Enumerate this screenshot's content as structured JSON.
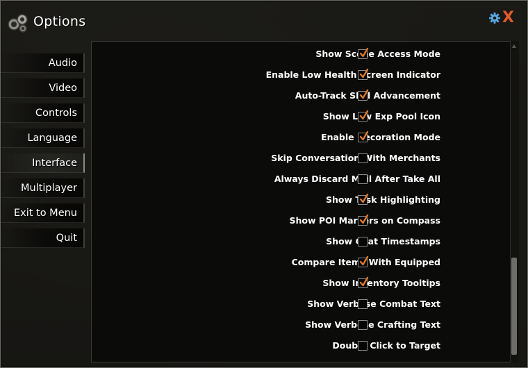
{
  "window": {
    "title": "Options"
  },
  "icons": {
    "logo": "gears-logo-icon",
    "settings": "gear-icon",
    "close": "close-icon",
    "close_glyph": "X"
  },
  "colors": {
    "accent_close": "#e05a2c",
    "gear": "#5aa8e0",
    "checkmark": "#e07a2a",
    "panel_bg": "#0b0b0a",
    "text": "#ffffff"
  },
  "nav": {
    "items": [
      {
        "label": "Audio",
        "active": false
      },
      {
        "label": "Video",
        "active": false
      },
      {
        "label": "Controls",
        "active": false
      },
      {
        "label": "Language",
        "active": false
      },
      {
        "label": "Interface",
        "active": true
      },
      {
        "label": "Multiplayer",
        "active": false
      },
      {
        "label": "Exit to Menu",
        "active": false
      },
      {
        "label": "Quit",
        "active": false
      }
    ]
  },
  "options": [
    {
      "label": "Show Scene Access Mode",
      "checked": true
    },
    {
      "label": "Enable Low Health Screen Indicator",
      "checked": true
    },
    {
      "label": "Auto-Track Skill Advancement",
      "checked": true
    },
    {
      "label": "Show Low Exp Pool Icon",
      "checked": true
    },
    {
      "label": "Enable Decoration Mode",
      "checked": true
    },
    {
      "label": "Skip Conversation With Merchants",
      "checked": false
    },
    {
      "label": "Always Discard Mail After Take All",
      "checked": false
    },
    {
      "label": "Show Task Highlighting",
      "checked": true
    },
    {
      "label": "Show POI Markers on Compass",
      "checked": true
    },
    {
      "label": "Show Chat Timestamps",
      "checked": false
    },
    {
      "label": "Compare Items With Equipped",
      "checked": true
    },
    {
      "label": "Show Inventory Tooltips",
      "checked": true
    },
    {
      "label": "Show Verbose Combat Text",
      "checked": false
    },
    {
      "label": "Show Verbose Crafting Text",
      "checked": false
    },
    {
      "label": "Double Click to Target",
      "checked": false
    }
  ]
}
